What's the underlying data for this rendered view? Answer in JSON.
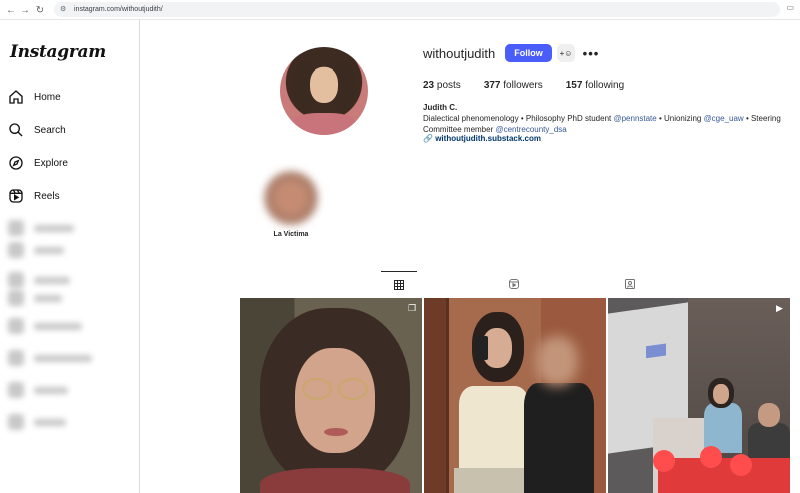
{
  "browser": {
    "url": "instagram.com/withoutjudith/"
  },
  "sidebar": {
    "logo": "Instagram",
    "items": [
      {
        "label": "Home",
        "icon": "home-icon"
      },
      {
        "label": "Search",
        "icon": "search-icon"
      },
      {
        "label": "Explore",
        "icon": "compass-icon"
      },
      {
        "label": "Reels",
        "icon": "reels-icon"
      }
    ]
  },
  "profile": {
    "username": "withoutjudith",
    "follow_label": "Follow",
    "stats": {
      "posts_count": "23",
      "posts_label": "posts",
      "followers_count": "377",
      "followers_label": "followers",
      "following_count": "157",
      "following_label": "following"
    },
    "full_name": "Judith C.",
    "bio": {
      "part1": "Dialectical phenomenology • Philosophy PhD student ",
      "mention1": "@pennstate",
      "part2": " • Unionizing ",
      "mention2": "@cge_uaw",
      "part3": " • Steering Committee member ",
      "mention3": "@centrecounty_dsa"
    },
    "link": "withoutjudith.substack.com"
  },
  "highlights": [
    {
      "label": "La Victima"
    }
  ],
  "tabs": [
    {
      "name": "posts",
      "icon": "grid-icon",
      "active": true
    },
    {
      "name": "reels",
      "icon": "reels-icon",
      "active": false
    },
    {
      "name": "tagged",
      "icon": "tagged-icon",
      "active": false
    }
  ],
  "posts": [
    {
      "type": "carousel",
      "badge_icon": "carousel-icon"
    },
    {
      "type": "photo"
    },
    {
      "type": "reel",
      "badge_icon": "reel-icon"
    }
  ],
  "colors": {
    "follow_button": "#4a5df9",
    "link": "#00376b",
    "mention": "#385898"
  }
}
